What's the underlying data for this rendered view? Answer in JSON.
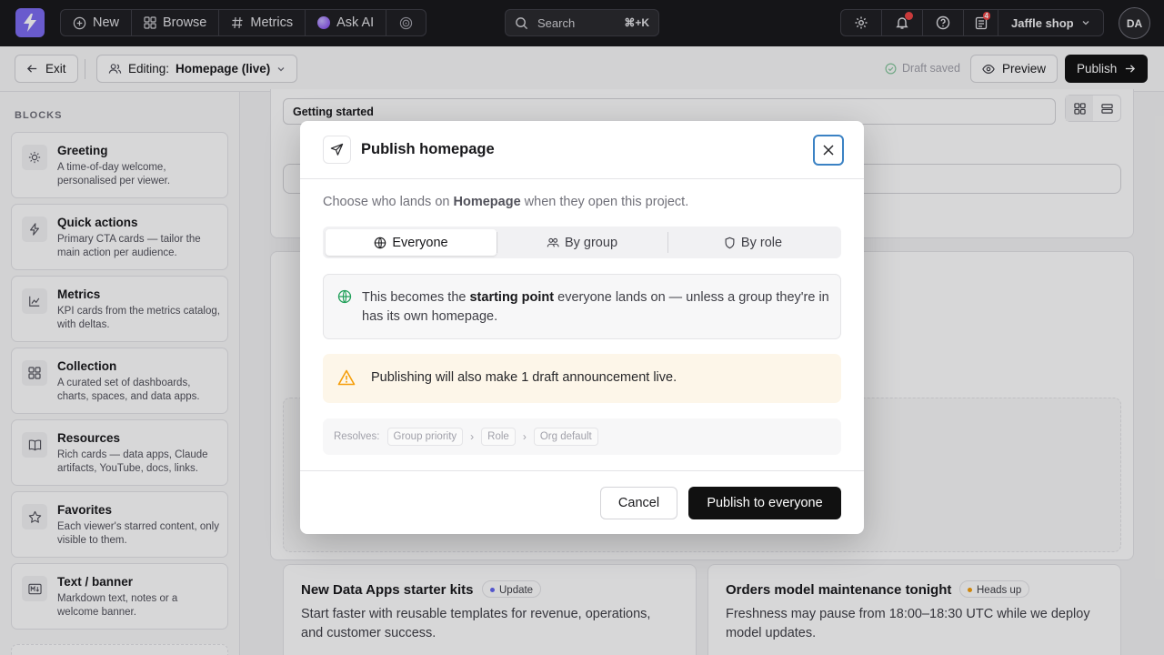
{
  "topbar": {
    "nav": [
      {
        "label": "New",
        "icon": "plus-circle-icon"
      },
      {
        "label": "Browse",
        "icon": "grid-icon"
      },
      {
        "label": "Metrics",
        "icon": "hash-icon"
      },
      {
        "label": "Ask AI",
        "icon": "ai-orb-icon"
      }
    ],
    "search": {
      "placeholder": "Search",
      "shortcut": "⌘+K"
    },
    "workspace": "Jaffle shop",
    "queue_count": "4",
    "avatar_initials": "DA",
    "brand_color": "#7c6cf2"
  },
  "editorbar": {
    "exit_label": "Exit",
    "editing_prefix": "Editing:",
    "editing_target": "Homepage (live)",
    "draft_status": "Draft saved",
    "preview_label": "Preview",
    "publish_label": "Publish"
  },
  "sidebar": {
    "section_label": "BLOCKS",
    "blocks": [
      {
        "title": "Greeting",
        "desc": "A time-of-day welcome, personalised per viewer.",
        "icon": "sun-icon"
      },
      {
        "title": "Quick actions",
        "desc": "Primary CTA cards — tailor the main action per audience.",
        "icon": "lightning-icon"
      },
      {
        "title": "Metrics",
        "desc": "KPI cards from the metrics catalog, with deltas.",
        "icon": "chart-icon"
      },
      {
        "title": "Collection",
        "desc": "A curated set of dashboards, charts, spaces, and data apps.",
        "icon": "grid-icon"
      },
      {
        "title": "Resources",
        "desc": "Rich cards — data apps, Claude artifacts, YouTube, docs, links.",
        "icon": "book-icon"
      },
      {
        "title": "Favorites",
        "desc": "Each viewer's starred content, only visible to them.",
        "icon": "star-icon"
      },
      {
        "title": "Text / banner",
        "desc": "Markdown text, notes or a welcome banner.",
        "icon": "markdown-icon"
      }
    ]
  },
  "main": {
    "getting_started": "Getting started",
    "announcements": [
      {
        "title": "New Data Apps starter kits",
        "badge": "Update",
        "badge_color": "#6366f1",
        "body": "Start faster with reusable templates for revenue, operations, and customer success."
      },
      {
        "title": "Orders model maintenance tonight",
        "badge": "Heads up",
        "badge_color": "#f59e0b",
        "body": "Freshness may pause from 18:00–18:30 UTC while we deploy model updates."
      }
    ]
  },
  "modal": {
    "title": "Publish homepage",
    "intro_prefix": "Choose who lands on",
    "intro_target": "Homepage",
    "intro_suffix": "when they open this project.",
    "tabs": [
      {
        "label": "Everyone",
        "icon": "globe-icon",
        "active": true
      },
      {
        "label": "By group",
        "icon": "users-icon",
        "active": false
      },
      {
        "label": "By role",
        "icon": "shield-icon",
        "active": false
      }
    ],
    "info_prefix": "This becomes the",
    "info_bold": "starting point",
    "info_suffix": "everyone lands on — unless a group they're in has its own homepage.",
    "warning": "Publishing will also make 1 draft announcement live.",
    "resolves_label": "Resolves:",
    "resolve_order": [
      "Group priority",
      "Role",
      "Org default"
    ],
    "cancel_label": "Cancel",
    "confirm_label": "Publish to everyone",
    "accent_color": "#3b82c4",
    "warning_color": "#f59e0b",
    "info_icon_color": "#22a05a"
  }
}
